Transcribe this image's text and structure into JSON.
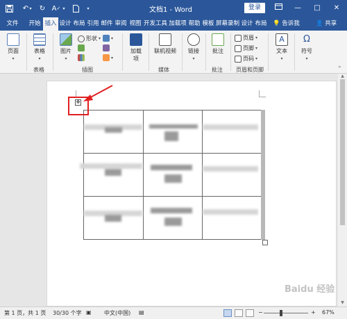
{
  "titlebar": {
    "save_icon": "save-icon",
    "undo_icon": "undo-icon",
    "redo_icon": "redo-icon",
    "title": "文档1 - Word",
    "login_label": "登录",
    "minimize": "—",
    "maximize": "□",
    "close": "✕"
  },
  "tabs": {
    "items": [
      "文件",
      "开始",
      "插入",
      "设计",
      "布局",
      "引用",
      "邮件",
      "审阅",
      "视图",
      "开发工具",
      "加载项",
      "帮助",
      "模板",
      "屏幕录制",
      "设计",
      "布局"
    ],
    "active_index": 2,
    "tellme": "告诉我",
    "share": "共享"
  },
  "ribbon": {
    "pages_label": "页面",
    "table_label": "表格",
    "table_group": "表格",
    "picture_label": "图片",
    "shapes_label": "形状",
    "illustrations_group": "插图",
    "addins_label": "加载项",
    "online_video_label": "联机视频",
    "media_group": "媒体",
    "link_label": "链接",
    "comment_label": "批注",
    "comment_group": "批注",
    "header_label": "页眉",
    "footer_label": "页脚",
    "pagenum_label": "页码",
    "hf_group": "页眉和页脚",
    "text_label": "文本",
    "symbol_label": "符号",
    "accent": "#2b579a"
  },
  "status": {
    "page": "第 1 页，共 1 页",
    "words": "30/30 个字",
    "lang": "中文(中国)",
    "zoom_minus": "−",
    "zoom_plus": "+",
    "zoom": "67%"
  },
  "watermark": "Baidu 经验"
}
